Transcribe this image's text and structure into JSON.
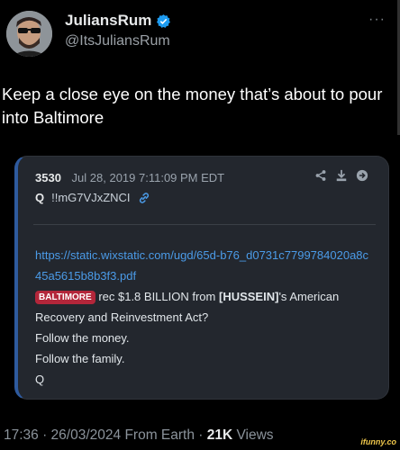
{
  "author": {
    "display_name": "JuliansRum",
    "handle": "@ItsJuliansRum"
  },
  "more_label": "···",
  "tweet": {
    "text": "Keep a close eye on the money that’s about to pour into Baltimore"
  },
  "quote": {
    "post_number": "3530",
    "timestamp": "Jul 28, 2019 7:11:09 PM EDT",
    "q_label": "Q",
    "tripcode": "!!mG7VJxZNCI",
    "link": "https://static.wixstatic.com/ugd/65d-b76_d0731c7799784020a8c45a5615b8b3f3.pdf",
    "badge": "BALTIMORE",
    "body_part1": " rec $1.8 BILLION from ",
    "body_bold": "[HUSSEIN]",
    "body_part2": "'s American Recovery and Reinvestment Act?",
    "line2": "Follow the money.",
    "line3": "Follow the family.",
    "sign": "Q"
  },
  "footer": {
    "meta": "17:36 · 26/03/2024 From Earth · ",
    "views_count": "21K",
    "views_label": " Views"
  },
  "watermark": "ifunny.co",
  "colors": {
    "background": "#000000",
    "link": "#4b9be8",
    "badge": "#b3263a",
    "verified": "#1d9bf0"
  }
}
